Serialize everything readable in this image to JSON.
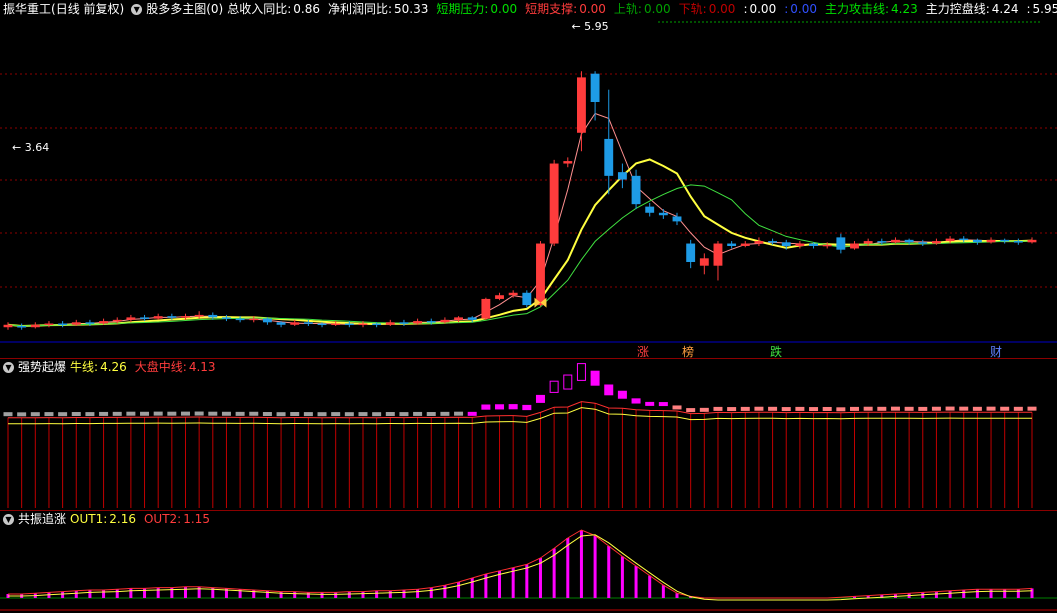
{
  "colors": {
    "up": "#ff3c3c",
    "down": "#1e9be6",
    "ma_white": "#ffffff",
    "ma_yellow": "#ffff40",
    "grid": "#8b0000",
    "pink": "#ff8080",
    "magenta": "#ff00ff",
    "green": "#00e000",
    "gray": "#a0a0a0",
    "blue_line": "#0000c8"
  },
  "main": {
    "symbol": "振华重工",
    "period": "(日线 前复权)",
    "indicator_name": "股多多主图(0)",
    "stats": [
      {
        "label": "总收入同比:",
        "value": "0.86",
        "color": "#ffffff"
      },
      {
        "label": "净利润同比:",
        "value": "50.33",
        "color": "#ffffff"
      },
      {
        "label": "短期压力:",
        "value": "0.00",
        "color": "#00e000"
      },
      {
        "label": "短期支撑:",
        "value": "0.00",
        "color": "#ff3c3c"
      },
      {
        "label": "上轨:",
        "value": "0.00",
        "color": "#00a000"
      },
      {
        "label": "下轨:",
        "value": "0.00",
        "color": "#c00000"
      },
      {
        "label": ":",
        "value": "0.00",
        "color": "#ffffff"
      },
      {
        "label": ":",
        "value": "0.00",
        "color": "#3050ff"
      },
      {
        "label": "主力攻击线:",
        "value": "4.23",
        "color": "#00e000"
      },
      {
        "label": "主力控盘线:",
        "value": "4.24",
        "color": "#ffffff"
      },
      {
        "label": ":",
        "value": "5.95",
        "color": "#ffffff"
      }
    ],
    "high_label": "5.95",
    "low_label": "3.64",
    "signals": [
      {
        "text": "涨",
        "color": "#ff4040"
      },
      {
        "text": "榜",
        "color": "#ffa040"
      },
      {
        "text": "跌",
        "color": "#40e040"
      },
      {
        "text": "财",
        "color": "#6080ff"
      }
    ]
  },
  "sub1": {
    "title": "强势起爆",
    "items": [
      {
        "label": "牛线:",
        "value": "4.26",
        "color": "#ffff40"
      },
      {
        "label": "大盘中线:",
        "value": "4.13",
        "color": "#ff3c3c"
      }
    ]
  },
  "sub2": {
    "title": "共振追涨",
    "items": [
      {
        "label": "OUT1:",
        "value": "2.16",
        "color": "#ffff40"
      },
      {
        "label": "OUT2:",
        "value": "1.15",
        "color": "#ff3c3c"
      }
    ]
  },
  "chart_data": [
    {
      "type": "candlestick",
      "title": "振华重工 (日线 前复权)",
      "y_range": [
        3.5,
        6.1
      ],
      "candles": [
        [
          3.62,
          3.64,
          3.6,
          3.66
        ],
        [
          3.63,
          3.62,
          3.6,
          3.65
        ],
        [
          3.62,
          3.64,
          3.61,
          3.66
        ],
        [
          3.64,
          3.65,
          3.62,
          3.67
        ],
        [
          3.65,
          3.64,
          3.62,
          3.67
        ],
        [
          3.64,
          3.66,
          3.63,
          3.68
        ],
        [
          3.66,
          3.65,
          3.63,
          3.68
        ],
        [
          3.65,
          3.67,
          3.64,
          3.69
        ],
        [
          3.67,
          3.68,
          3.65,
          3.7
        ],
        [
          3.68,
          3.7,
          3.66,
          3.72
        ],
        [
          3.7,
          3.69,
          3.67,
          3.72
        ],
        [
          3.69,
          3.71,
          3.68,
          3.73
        ],
        [
          3.71,
          3.7,
          3.68,
          3.73
        ],
        [
          3.7,
          3.71,
          3.68,
          3.73
        ],
        [
          3.71,
          3.72,
          3.69,
          3.75
        ],
        [
          3.72,
          3.7,
          3.68,
          3.74
        ],
        [
          3.7,
          3.69,
          3.67,
          3.72
        ],
        [
          3.69,
          3.68,
          3.66,
          3.71
        ],
        [
          3.68,
          3.69,
          3.66,
          3.71
        ],
        [
          3.69,
          3.66,
          3.64,
          3.7
        ],
        [
          3.66,
          3.64,
          3.62,
          3.67
        ],
        [
          3.64,
          3.66,
          3.63,
          3.68
        ],
        [
          3.66,
          3.65,
          3.63,
          3.68
        ],
        [
          3.65,
          3.64,
          3.62,
          3.66
        ],
        [
          3.64,
          3.65,
          3.63,
          3.67
        ],
        [
          3.65,
          3.64,
          3.62,
          3.67
        ],
        [
          3.64,
          3.65,
          3.62,
          3.67
        ],
        [
          3.65,
          3.64,
          3.62,
          3.66
        ],
        [
          3.64,
          3.66,
          3.63,
          3.68
        ],
        [
          3.66,
          3.65,
          3.63,
          3.68
        ],
        [
          3.65,
          3.67,
          3.64,
          3.69
        ],
        [
          3.67,
          3.66,
          3.64,
          3.69
        ],
        [
          3.66,
          3.68,
          3.65,
          3.7
        ],
        [
          3.68,
          3.7,
          3.66,
          3.71
        ],
        [
          3.7,
          3.68,
          3.66,
          3.71
        ],
        [
          3.69,
          3.85,
          3.68,
          3.86
        ],
        [
          3.85,
          3.88,
          3.84,
          3.9
        ],
        [
          3.88,
          3.9,
          3.86,
          3.92
        ],
        [
          3.9,
          3.8,
          3.78,
          3.92
        ],
        [
          3.8,
          4.3,
          3.79,
          4.32
        ],
        [
          4.3,
          4.95,
          4.28,
          4.98
        ],
        [
          4.95,
          4.97,
          4.92,
          5.0
        ],
        [
          5.2,
          5.65,
          5.05,
          5.7
        ],
        [
          5.68,
          5.45,
          5.3,
          5.7
        ],
        [
          5.15,
          4.85,
          4.7,
          5.55
        ],
        [
          4.88,
          4.82,
          4.75,
          4.95
        ],
        [
          4.85,
          4.62,
          4.58,
          4.9
        ],
        [
          4.6,
          4.55,
          4.52,
          4.63
        ],
        [
          4.55,
          4.53,
          4.5,
          4.58
        ],
        [
          4.52,
          4.48,
          4.45,
          4.55
        ],
        [
          4.3,
          4.15,
          4.1,
          4.33
        ],
        [
          4.12,
          4.18,
          4.05,
          4.22
        ],
        [
          4.12,
          4.3,
          4.0,
          4.32
        ],
        [
          4.3,
          4.28,
          4.26,
          4.32
        ],
        [
          4.28,
          4.3,
          4.27,
          4.32
        ],
        [
          4.3,
          4.32,
          4.28,
          4.35
        ],
        [
          4.32,
          4.31,
          4.29,
          4.34
        ],
        [
          4.31,
          4.28,
          4.25,
          4.33
        ],
        [
          4.28,
          4.3,
          4.26,
          4.32
        ],
        [
          4.3,
          4.28,
          4.26,
          4.31
        ],
        [
          4.28,
          4.29,
          4.26,
          4.31
        ],
        [
          4.35,
          4.25,
          4.22,
          4.38
        ],
        [
          4.26,
          4.3,
          4.25,
          4.32
        ],
        [
          4.3,
          4.32,
          4.28,
          4.34
        ],
        [
          4.32,
          4.31,
          4.29,
          4.34
        ],
        [
          4.31,
          4.33,
          4.3,
          4.35
        ],
        [
          4.33,
          4.31,
          4.29,
          4.34
        ],
        [
          4.31,
          4.3,
          4.28,
          4.33
        ],
        [
          4.3,
          4.32,
          4.29,
          4.34
        ],
        [
          4.32,
          4.34,
          4.3,
          4.36
        ],
        [
          4.34,
          4.33,
          4.31,
          4.36
        ],
        [
          4.33,
          4.31,
          4.29,
          4.34
        ],
        [
          4.31,
          4.33,
          4.3,
          4.35
        ],
        [
          4.33,
          4.32,
          4.3,
          4.34
        ],
        [
          4.32,
          4.31,
          4.29,
          4.34
        ],
        [
          4.31,
          4.33,
          4.3,
          4.35
        ]
      ]
    },
    {
      "type": "bar",
      "title": "强势起爆",
      "values": [
        0.1,
        0.1,
        0.1,
        0.1,
        0.1,
        0.1,
        0.1,
        0.1,
        0.1,
        0.1,
        0.1,
        0.1,
        0.1,
        0.1,
        0.1,
        0.1,
        0.1,
        0.1,
        0.1,
        0.1,
        0.1,
        0.1,
        0.1,
        0.1,
        0.1,
        0.1,
        0.1,
        0.1,
        0.1,
        0.1,
        0.1,
        0.1,
        0.1,
        0.1,
        0.1,
        0.3,
        0.3,
        0.3,
        0.3,
        0.5,
        0.8,
        1.0,
        1.2,
        1.0,
        0.7,
        0.5,
        0.3,
        0.2,
        0.2,
        0.1,
        0.1,
        0.1,
        0.1,
        0.1,
        0.1,
        0.1,
        0.1,
        0.1,
        0.1,
        0.1,
        0.1,
        0.1,
        0.1,
        0.1,
        0.1,
        0.1,
        0.1,
        0.1,
        0.1,
        0.1,
        0.1,
        0.1,
        0.1,
        0.1,
        0.1,
        0.1
      ]
    },
    {
      "type": "bar",
      "title": "共振追涨",
      "values": [
        0.05,
        0.05,
        0.06,
        0.07,
        0.08,
        0.09,
        0.1,
        0.1,
        0.11,
        0.12,
        0.12,
        0.13,
        0.13,
        0.14,
        0.14,
        0.13,
        0.12,
        0.11,
        0.1,
        0.09,
        0.08,
        0.08,
        0.07,
        0.07,
        0.07,
        0.08,
        0.08,
        0.09,
        0.09,
        0.1,
        0.11,
        0.13,
        0.16,
        0.2,
        0.25,
        0.3,
        0.34,
        0.38,
        0.42,
        0.5,
        0.62,
        0.75,
        0.85,
        0.78,
        0.65,
        0.52,
        0.4,
        0.28,
        0.16,
        0.06,
        0.02,
        0.0,
        0.0,
        0.0,
        0.0,
        0.0,
        0.0,
        0.0,
        0.0,
        0.0,
        0.0,
        0.01,
        0.02,
        0.03,
        0.04,
        0.05,
        0.06,
        0.07,
        0.08,
        0.09,
        0.1,
        0.11,
        0.11,
        0.11,
        0.11,
        0.12
      ]
    }
  ]
}
